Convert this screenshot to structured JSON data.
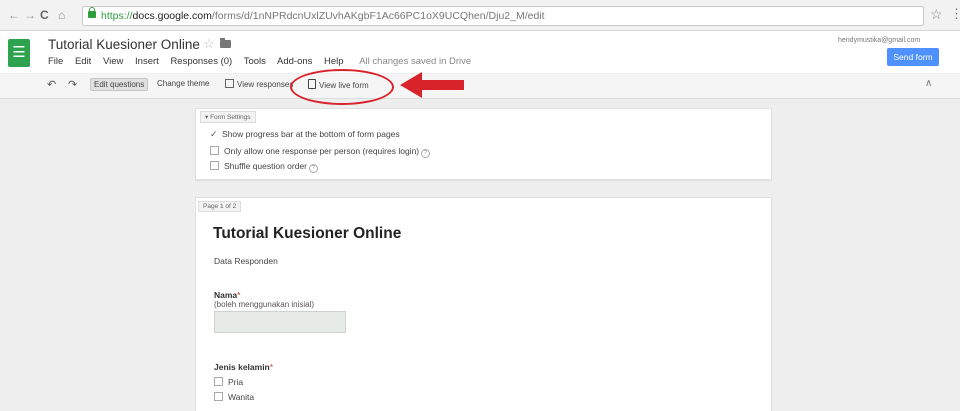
{
  "browser": {
    "url_scheme": "https://",
    "url_host": "docs.google.com",
    "url_path": "/forms/d/1nNPRdcnUxlZUvhAKgbF1Ac66PC1oX9UCQhen/Dju2_M/edit"
  },
  "header": {
    "doc_title": "Tutorial Kuesioner Online",
    "menu": [
      "File",
      "Edit",
      "View",
      "Insert",
      "Responses (0)",
      "Tools",
      "Add-ons",
      "Help"
    ],
    "save_status": "All changes saved in Drive",
    "account": "hendymustika@gmail.com",
    "send_label": "Send form"
  },
  "toolbar": {
    "edit_questions": "Edit questions",
    "change_theme": "Change theme",
    "view_responses": "View responses",
    "view_live_form": "View live form"
  },
  "settings": {
    "tab_label": "Form Settings",
    "options": [
      {
        "label": "Show progress bar at the bottom of form pages",
        "checked": true
      },
      {
        "label": "Only allow one response per person (requires login)",
        "checked": false
      },
      {
        "label": "Shuffle question order",
        "checked": false
      }
    ]
  },
  "form": {
    "page_label": "Page 1 of 2",
    "title": "Tutorial Kuesioner Online",
    "description": "Data Responden",
    "q1_label": "Nama",
    "q1_required": "*",
    "q1_help": "(boleh menggunakan inisial)",
    "q2_label": "Jenis kelamin",
    "q2_required": "*",
    "q2_options": [
      "Pria",
      "Wanita"
    ]
  },
  "colors": {
    "annotation_red": "#d9232b",
    "app_green": "#2ea34f",
    "send_blue": "#4d90fe"
  }
}
